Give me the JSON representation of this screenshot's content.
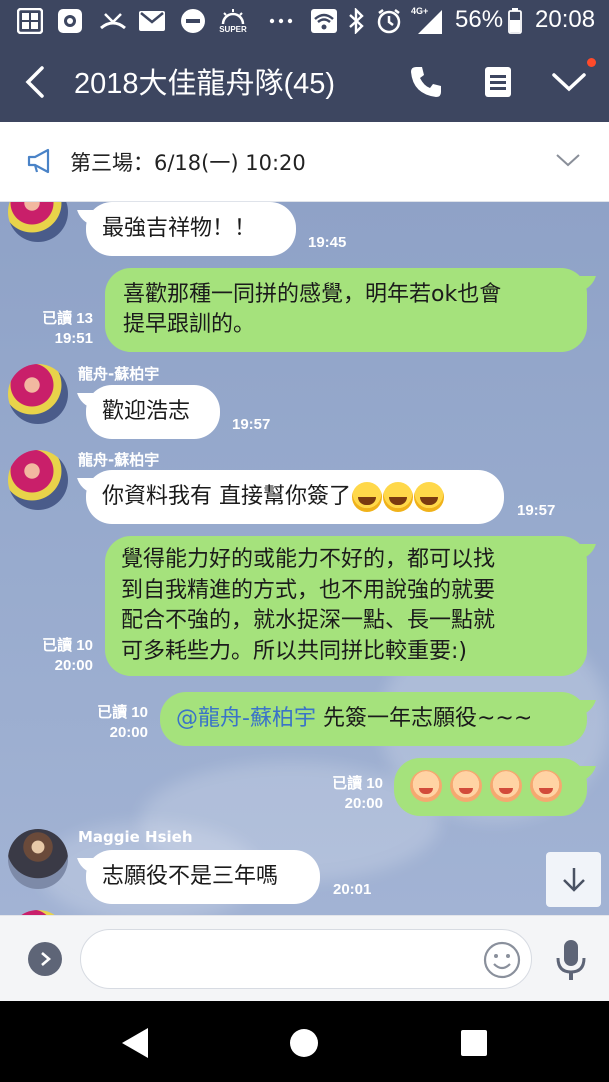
{
  "status_bar": {
    "network_label": "4G+",
    "super_label": "SUPER",
    "battery_percent": "56%",
    "time": "20:08"
  },
  "header": {
    "title": "2018大佳龍舟隊(45)"
  },
  "announcement": {
    "text": "第三場：6/18(一)  10:20"
  },
  "messages": [
    {
      "text": "最強吉祥物！！",
      "time": "19:45"
    },
    {
      "text_line1": "喜歡那種一同拼的感覺，明年若ok也會",
      "text_line2": "提早跟訓的。",
      "read": "已讀 13",
      "time": "19:51"
    },
    {
      "sender": "龍舟-蘇柏宇",
      "text": "歡迎浩志",
      "time": "19:57"
    },
    {
      "sender": "龍舟-蘇柏宇",
      "text": "你資料我有  直接幫你簽了",
      "time": "19:57"
    },
    {
      "line1": "覺得能力好的或能力不好的，都可以找",
      "line2": "到自我精進的方式，也不用說強的就要",
      "line3": "配合不強的，就水捉深一點、長一點就",
      "line4": "可多耗些力。所以共同拼比較重要:)",
      "read": "已讀 10",
      "time": "20:00"
    },
    {
      "mention": "@龍舟-蘇柏宇",
      "text": " 先簽一年志願役~~~",
      "read": "已讀 10",
      "time": "20:00"
    },
    {
      "read": "已讀 10",
      "time": "20:00"
    },
    {
      "sender": "Maggie Hsieh",
      "text": "志願役不是三年嗎",
      "time": "20:01"
    }
  ],
  "icons": {
    "back": "back-arrow-icon",
    "call": "phone-icon",
    "notes": "notes-icon",
    "menu": "chevron-down-icon",
    "announce": "megaphone-icon",
    "scroll": "arrow-down-icon",
    "emoji": "smiley-icon",
    "mic": "microphone-icon"
  },
  "colors": {
    "header_bg": "#3d4660",
    "outgoing_bubble": "#a5e27c",
    "incoming_bubble": "#ffffff",
    "mention": "#3a73c8",
    "notification_dot": "#ff4a2a"
  }
}
